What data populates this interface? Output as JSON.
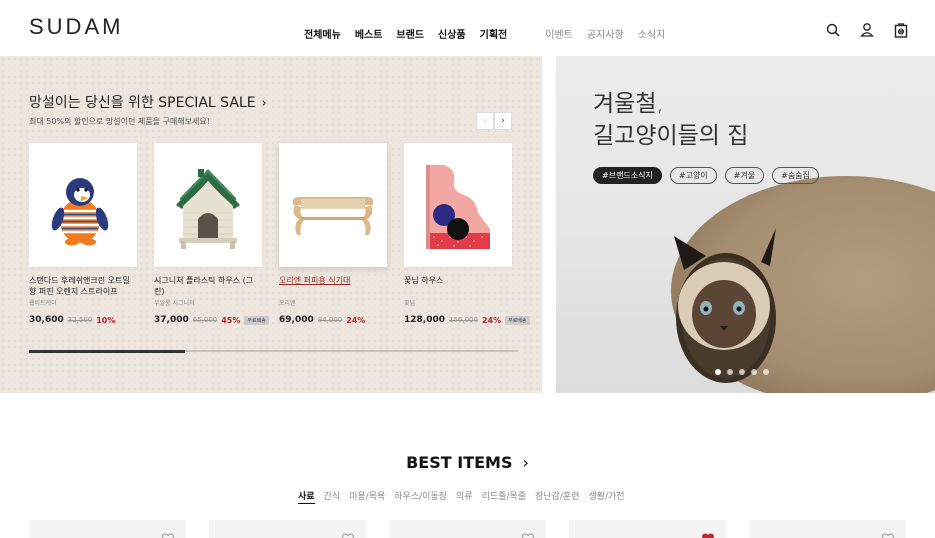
{
  "header": {
    "logo": "SUDAM",
    "nav_main": [
      "전체메뉴",
      "베스트",
      "브랜드",
      "신상품",
      "기획전"
    ],
    "nav_sub": [
      "이벤트",
      "공지사항",
      "소식지"
    ],
    "cart_count": "0"
  },
  "sale": {
    "title": "망설이는 당신을 위한 SPECIAL SALE",
    "subtitle": "최대 50%의 할인으로 망설이던 제품을 구매해보세요!",
    "products": [
      {
        "name": "스탠다드 후레쉬앤크린 오트밀 향 퍼핀 오렌지 스트라이프",
        "brand": "웹비트케이",
        "price": "30,600",
        "original": "32,500",
        "discount": "10%",
        "shipping": ""
      },
      {
        "name": "시그니처 플라스틱 하우스 (그린)",
        "brand": "우알롱 시그니처",
        "price": "37,000",
        "original": "65,000",
        "discount": "45%",
        "shipping": "무료배송"
      },
      {
        "name": "오리엔 퍼피용 식기대",
        "brand": "오리엔",
        "price": "69,000",
        "original": "84,000",
        "discount": "24%",
        "shipping": ""
      },
      {
        "name": "꽃님 하우스",
        "brand": "꽃님",
        "price": "128,000",
        "original": "156,000",
        "discount": "24%",
        "shipping": "무료배송"
      }
    ],
    "progress": 0.32
  },
  "banner": {
    "title_line1": "겨울철,",
    "title_line2": "길고양이들의 집",
    "tags": [
      "#브랜드소식지",
      "#고양이",
      "#겨울",
      "#숨숨집"
    ],
    "active_dot": 0,
    "dot_count": 5
  },
  "best": {
    "title": "BEST ITEMS",
    "categories": [
      "사료",
      "간식",
      "미용/목욕",
      "하우스/이동장",
      "의류",
      "리드줄/목줄",
      "장난감/훈련",
      "생활/가전"
    ],
    "liked": [
      false,
      false,
      false,
      true,
      false
    ]
  },
  "colors": {
    "accent": "#c0262c",
    "dark": "#222222"
  }
}
